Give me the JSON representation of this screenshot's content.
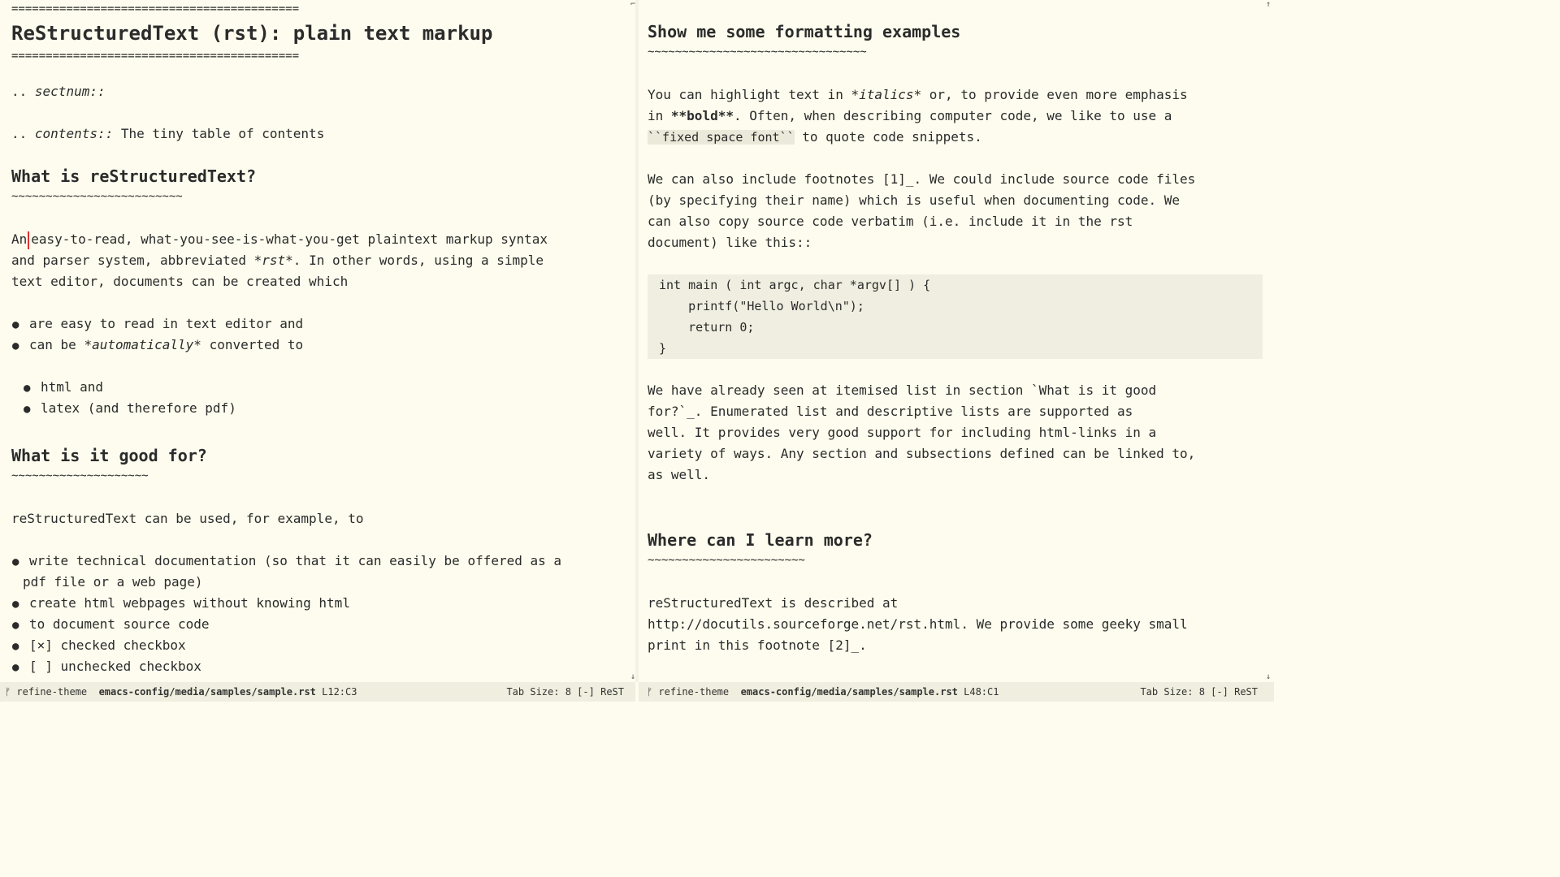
{
  "left": {
    "title_rule": "==========================================",
    "title": "ReStructuredText (rst): plain text markup",
    "directive_sectnum_prefix": ".. ",
    "directive_sectnum": "sectnum::",
    "directive_contents_prefix": ".. ",
    "directive_contents": "contents::",
    "directive_contents_arg": " The tiny table of contents",
    "h_what": "What is reStructuredText?",
    "h_what_rule": "~~~~~~~~~~~~~~~~~~~~~~~~~",
    "para1_l1_a": "An",
    "para1_l1_b": "easy-to-read, what-you-see-is-what-you-get plaintext markup syntax",
    "para1_l2_a": "and parser system, abbreviated ",
    "para1_l2_em": "*rst*",
    "para1_l2_b": ". In other words, using a simple",
    "para1_l3": "text editor, documents can be created which",
    "bullet1": "are easy to read in text editor and",
    "bullet2_a": "can be ",
    "bullet2_em": "*automatically*",
    "bullet2_b": " converted to",
    "sub1": "html and",
    "sub2": "latex (and therefore pdf)",
    "h_good": "What is it good for?",
    "h_good_rule": "~~~~~~~~~~~~~~~~~~~~",
    "good_intro": "reStructuredText can be used, for example, to",
    "good1_l1": "write technical documentation (so that it can easily be offered as a",
    "good1_l2": "pdf file or a web page)",
    "good2": "create html webpages without knowing html",
    "good3": "to document source code",
    "good4": "[×] checked checkbox",
    "good5": "[ ] unchecked checkbox"
  },
  "right": {
    "h_fmt": "Show me some formatting examples",
    "h_fmt_rule": "~~~~~~~~~~~~~~~~~~~~~~~~~~~~~~~~",
    "p1_l1_a": "You can highlight text in ",
    "p1_l1_em": "*italics*",
    "p1_l1_b": " or, to provide even more emphasis",
    "p1_l2_a": "in ",
    "p1_l2_strong": "**bold**",
    "p1_l2_b": ". Often, when describing computer code, we like to use a",
    "p1_l3_code": "``fixed space font``",
    "p1_l3_b": " to quote code snippets.",
    "p2_l1": "We can also include footnotes [1]_. We could include source code files",
    "p2_l2": "(by specifying their name) which is useful when documenting code. We",
    "p2_l3": "can also copy source code verbatim (i.e. include it in the rst",
    "p2_l4": "document) like this::",
    "code1": "int main ( int argc, char *argv[] ) {",
    "code2": "    printf(\"Hello World\\n\");",
    "code3": "    return 0;",
    "code4": "}",
    "p3_l1": "We have already seen at itemised list in section `What is it good",
    "p3_l2": "for?`_. Enumerated list and descriptive lists are supported as",
    "p3_l3": "well. It provides very good support for including html-links in a",
    "p3_l4": "variety of ways. Any section and subsections defined can be linked to,",
    "p3_l5": "as well.",
    "h_learn": "Where can I learn more?",
    "h_learn_rule": "~~~~~~~~~~~~~~~~~~~~~~~",
    "p4_l1": "reStructuredText is described at",
    "p4_l2": "http://docutils.sourceforge.net/rst.html. We provide some geeky small",
    "p4_l3": "print in this footnote [2]_."
  },
  "modeline_left": {
    "branch_icon": "ᚠ",
    "branch": " refine-theme",
    "file": "emacs-config/media/samples/sample.rst",
    "pos": "L12:C3",
    "tab": "Tab Size: 8",
    "flag": "[-]",
    "mode": "ReST"
  },
  "modeline_right": {
    "branch_icon": "ᚠ",
    "branch": " refine-theme",
    "file": "emacs-config/media/samples/sample.rst",
    "pos": "L48:C1",
    "tab": "Tab Size: 8",
    "flag": "[-]",
    "mode": "ReST"
  }
}
